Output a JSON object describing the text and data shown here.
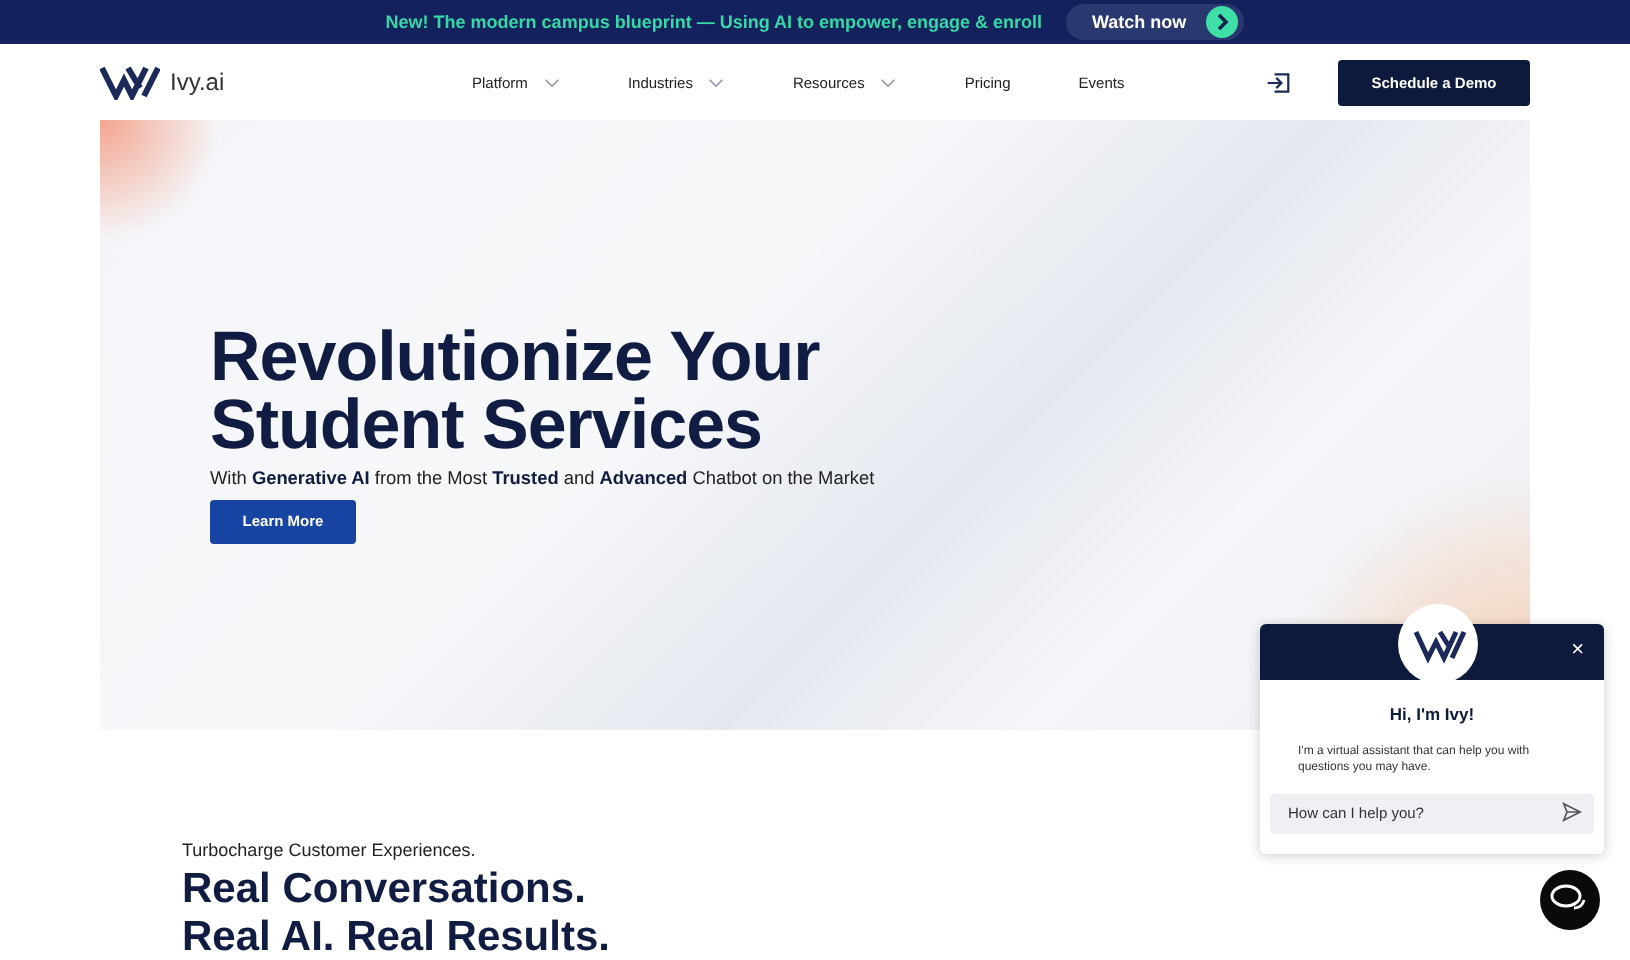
{
  "announcement": {
    "text": "New! The modern campus blueprint — Using AI to empower, engage & enroll",
    "button": "Watch now"
  },
  "header": {
    "logo_text": "Ivy.ai",
    "nav": [
      {
        "label": "Platform",
        "dropdown": true
      },
      {
        "label": "Industries",
        "dropdown": true
      },
      {
        "label": "Resources",
        "dropdown": true
      },
      {
        "label": "Pricing",
        "dropdown": false
      },
      {
        "label": "Events",
        "dropdown": false
      }
    ],
    "cta": "Schedule a Demo"
  },
  "hero": {
    "title_lines": [
      "Revolutionize Your",
      "Student Services"
    ],
    "subtitle": "With **Generative AI** from the Most **Trusted** and **Advanced** Chatbot on the Market",
    "button": "Learn More"
  },
  "section": {
    "eyebrow": "Turbocharge Customer Experiences.",
    "title_lines": [
      "Real Conversations.",
      "Real AI. Real Results."
    ]
  },
  "chat": {
    "close": "×",
    "greeting": "Hi, I'm Ivy!",
    "message": "I'm a virtual assistant that can help you with questions you may have.",
    "input": {
      "placeholder": "How can I help you?"
    }
  }
}
